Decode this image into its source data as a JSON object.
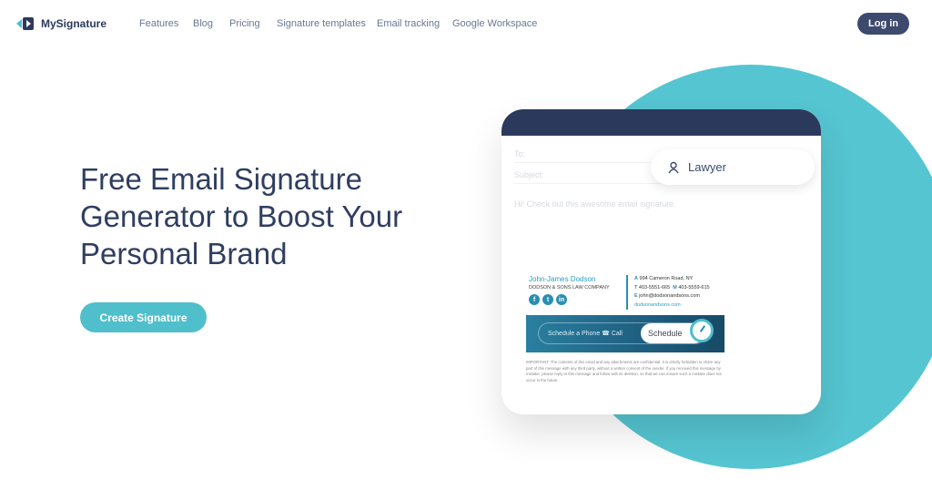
{
  "nav": {
    "brand": "MySignature",
    "items": [
      "Features",
      "Blog",
      "Pricing",
      "Signature templates",
      "Email tracking",
      "Google Workspace"
    ],
    "login": "Log in"
  },
  "hero": {
    "title_lines": [
      "Free Email Signature",
      "Generator to Boost Your",
      "Personal Brand"
    ],
    "cta": "Create Signature"
  },
  "preview": {
    "to": "To:",
    "subject": "Subject:",
    "body": "Hi! Check out this awesome email signature.",
    "role": "Lawyer",
    "signature": {
      "name": "John-James Dodson",
      "company": "DODSON & SONS LAW COMPANY",
      "socials": [
        "facebook",
        "twitter",
        "linkedin"
      ],
      "address_label": "A",
      "address": "994 Cameron Road, NY",
      "phone_label": "T",
      "phone": "403-5551-665",
      "mobile_label": "M",
      "mobile": "403-5559-615",
      "email_label": "E",
      "email": "john@dodsonandsons.com",
      "website": "dodsonandsons.com"
    },
    "banner": {
      "text": "Schedule a Phone ☎ Call",
      "button": "Schedule"
    },
    "disclaimer": "IMPORTANT: The contents of this email and any attachments are confidential. It is strictly forbidden to share any part of this message with any third party, without a written consent of the sender. If you received this message by mistake, please reply to this message and follow with its deletion, so that we can ensure such a mistake does not occur in the future."
  },
  "colors": {
    "accent": "#4fbfcb",
    "navy": "#2b3a5c",
    "circle": "#55c5d1"
  }
}
